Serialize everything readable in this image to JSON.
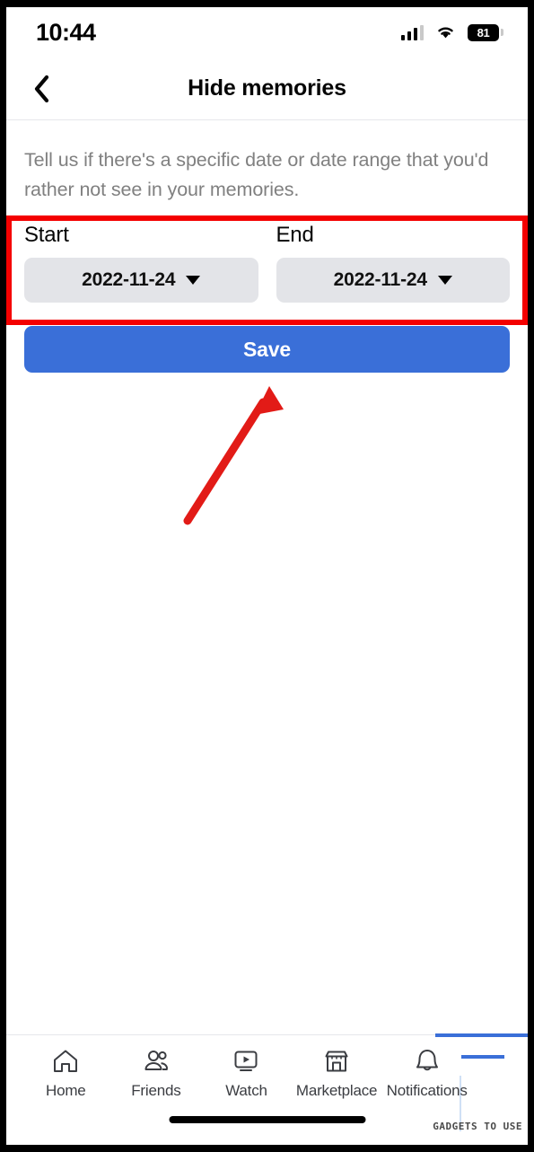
{
  "status_bar": {
    "time": "10:44",
    "battery_level": "81",
    "signal_icon": "cellular-signal-icon",
    "wifi_icon": "wifi-icon",
    "battery_icon": "battery-icon"
  },
  "header": {
    "back_icon": "chevron-left-icon",
    "title": "Hide memories"
  },
  "main": {
    "description": "Tell us if there's a specific date or date range that you'd rather not see in your memories.",
    "date_range": {
      "start": {
        "label": "Start",
        "value": "2022-11-24",
        "caret_icon": "chevron-down-icon"
      },
      "end": {
        "label": "End",
        "value": "2022-11-24",
        "caret_icon": "chevron-down-icon"
      }
    },
    "save_label": "Save"
  },
  "bottom_nav": {
    "tabs": [
      {
        "label": "Home",
        "icon": "home-icon"
      },
      {
        "label": "Friends",
        "icon": "friends-icon"
      },
      {
        "label": "Watch",
        "icon": "watch-video-icon"
      },
      {
        "label": "Marketplace",
        "icon": "marketplace-store-icon"
      },
      {
        "label": "Notifications",
        "icon": "bell-icon"
      }
    ]
  },
  "watermark": "GADGETS TO USE",
  "colors": {
    "accent_blue": "#3a6fd8",
    "annotation_red": "#f40000",
    "field_gray": "#e3e4e8",
    "muted_text": "#808080"
  }
}
